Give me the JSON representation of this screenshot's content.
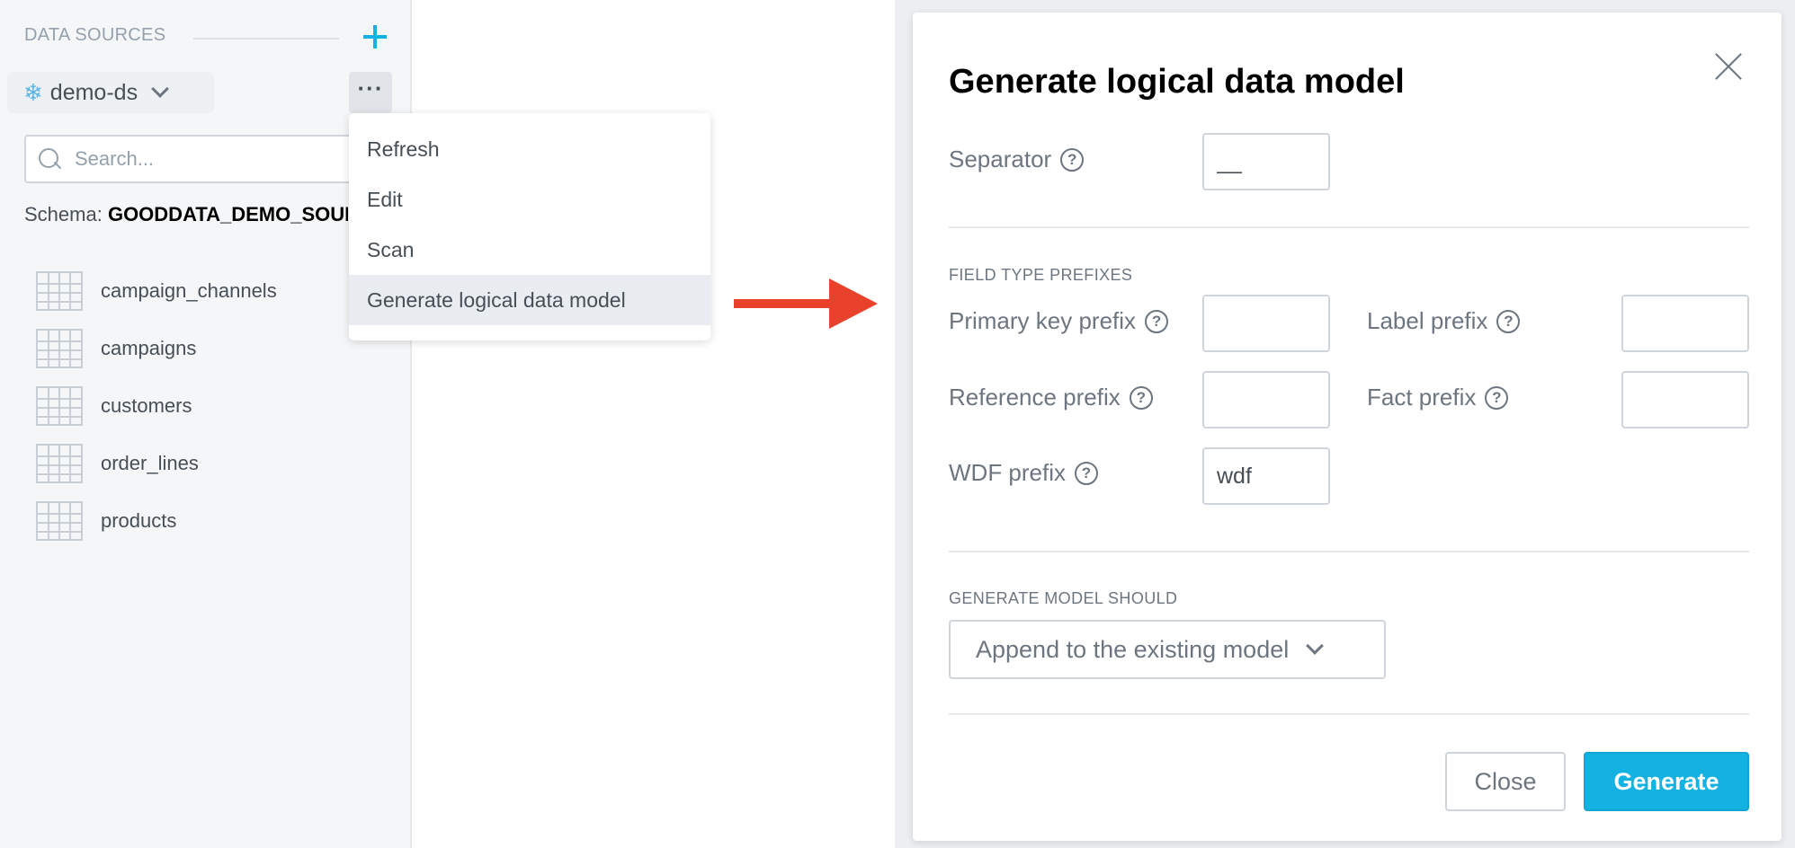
{
  "sidebar": {
    "header": "DATA SOURCES",
    "data_source": {
      "name": "demo-ds",
      "icon": "snowflake-icon"
    },
    "more_label": "···",
    "search": {
      "placeholder": "Search...",
      "value": ""
    },
    "schema_label": "Schema:",
    "schema_value": "GOODDATA_DEMO_SOURCE",
    "tables": [
      "campaign_channels",
      "campaigns",
      "customers",
      "order_lines",
      "products"
    ]
  },
  "menu": {
    "items": [
      "Refresh",
      "Edit",
      "Scan",
      "Generate logical data model"
    ],
    "active_index": 3
  },
  "dialog": {
    "title": "Generate logical data model",
    "separator": {
      "label": "Separator",
      "value": "__"
    },
    "field_type_section": "FIELD TYPE PREFIXES",
    "primary_key": {
      "label": "Primary key prefix",
      "value": ""
    },
    "label_prefix": {
      "label": "Label prefix",
      "value": ""
    },
    "reference": {
      "label": "Reference prefix",
      "value": ""
    },
    "fact": {
      "label": "Fact prefix",
      "value": ""
    },
    "wdf": {
      "label": "WDF prefix",
      "value": "wdf"
    },
    "generate_section": "GENERATE MODEL SHOULD",
    "generate_option": "Append to the existing model",
    "close_label": "Close",
    "generate_label": "Generate",
    "help_glyph": "?"
  },
  "colors": {
    "accent": "#14b2e2",
    "arrow": "#e8412c"
  }
}
